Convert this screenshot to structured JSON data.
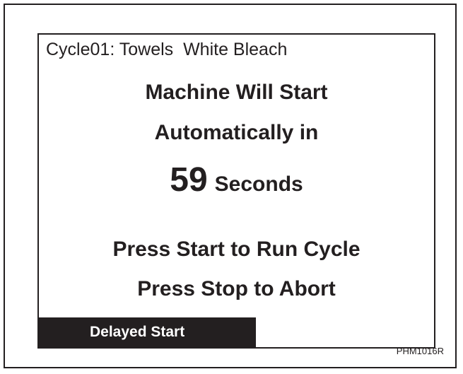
{
  "display": {
    "cycle_line": "Cycle01: Towels  White Bleach",
    "message_line_1": "Machine Will Start",
    "message_line_2": "Automatically in",
    "countdown_value": "59",
    "countdown_unit": "Seconds",
    "instruction_start": "Press Start to Run Cycle",
    "instruction_stop": "Press Stop to Abort",
    "status_label": "Delayed Start"
  },
  "figure": {
    "id": "PHM1016R"
  },
  "colors": {
    "ink": "#231f20",
    "background": "#ffffff",
    "status_bar_text": "#ffffff"
  }
}
